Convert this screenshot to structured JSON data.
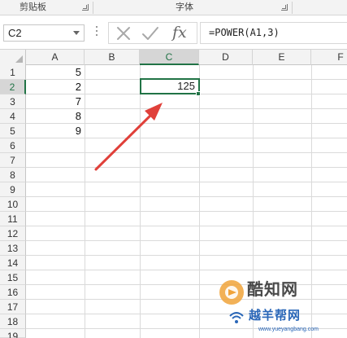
{
  "ribbon": {
    "groups": [
      {
        "label": "剪贴板"
      },
      {
        "label": "字体"
      }
    ]
  },
  "formula_bar": {
    "name_box": "C2",
    "fx_label": "fx",
    "formula": "=POWER(A1,3)"
  },
  "sheet": {
    "columns": [
      "A",
      "B",
      "C",
      "D",
      "E",
      "F"
    ],
    "rows": [
      "1",
      "2",
      "3",
      "4",
      "5",
      "6",
      "7",
      "8",
      "9",
      "10",
      "11",
      "12",
      "13",
      "14",
      "15",
      "16",
      "17",
      "18",
      "19"
    ],
    "active_column": "C",
    "active_row": "2",
    "column_a_values": [
      "5",
      "2",
      "7",
      "8",
      "9"
    ],
    "selected_cell_value": "125"
  },
  "watermark": {
    "title": "酷知网",
    "subtitle": "越羊帮网",
    "url": "www.yueyangbang.com"
  },
  "colors": {
    "accent": "#217346",
    "arrow": "#e0403a",
    "watermark_blue": "#2a67b8"
  }
}
